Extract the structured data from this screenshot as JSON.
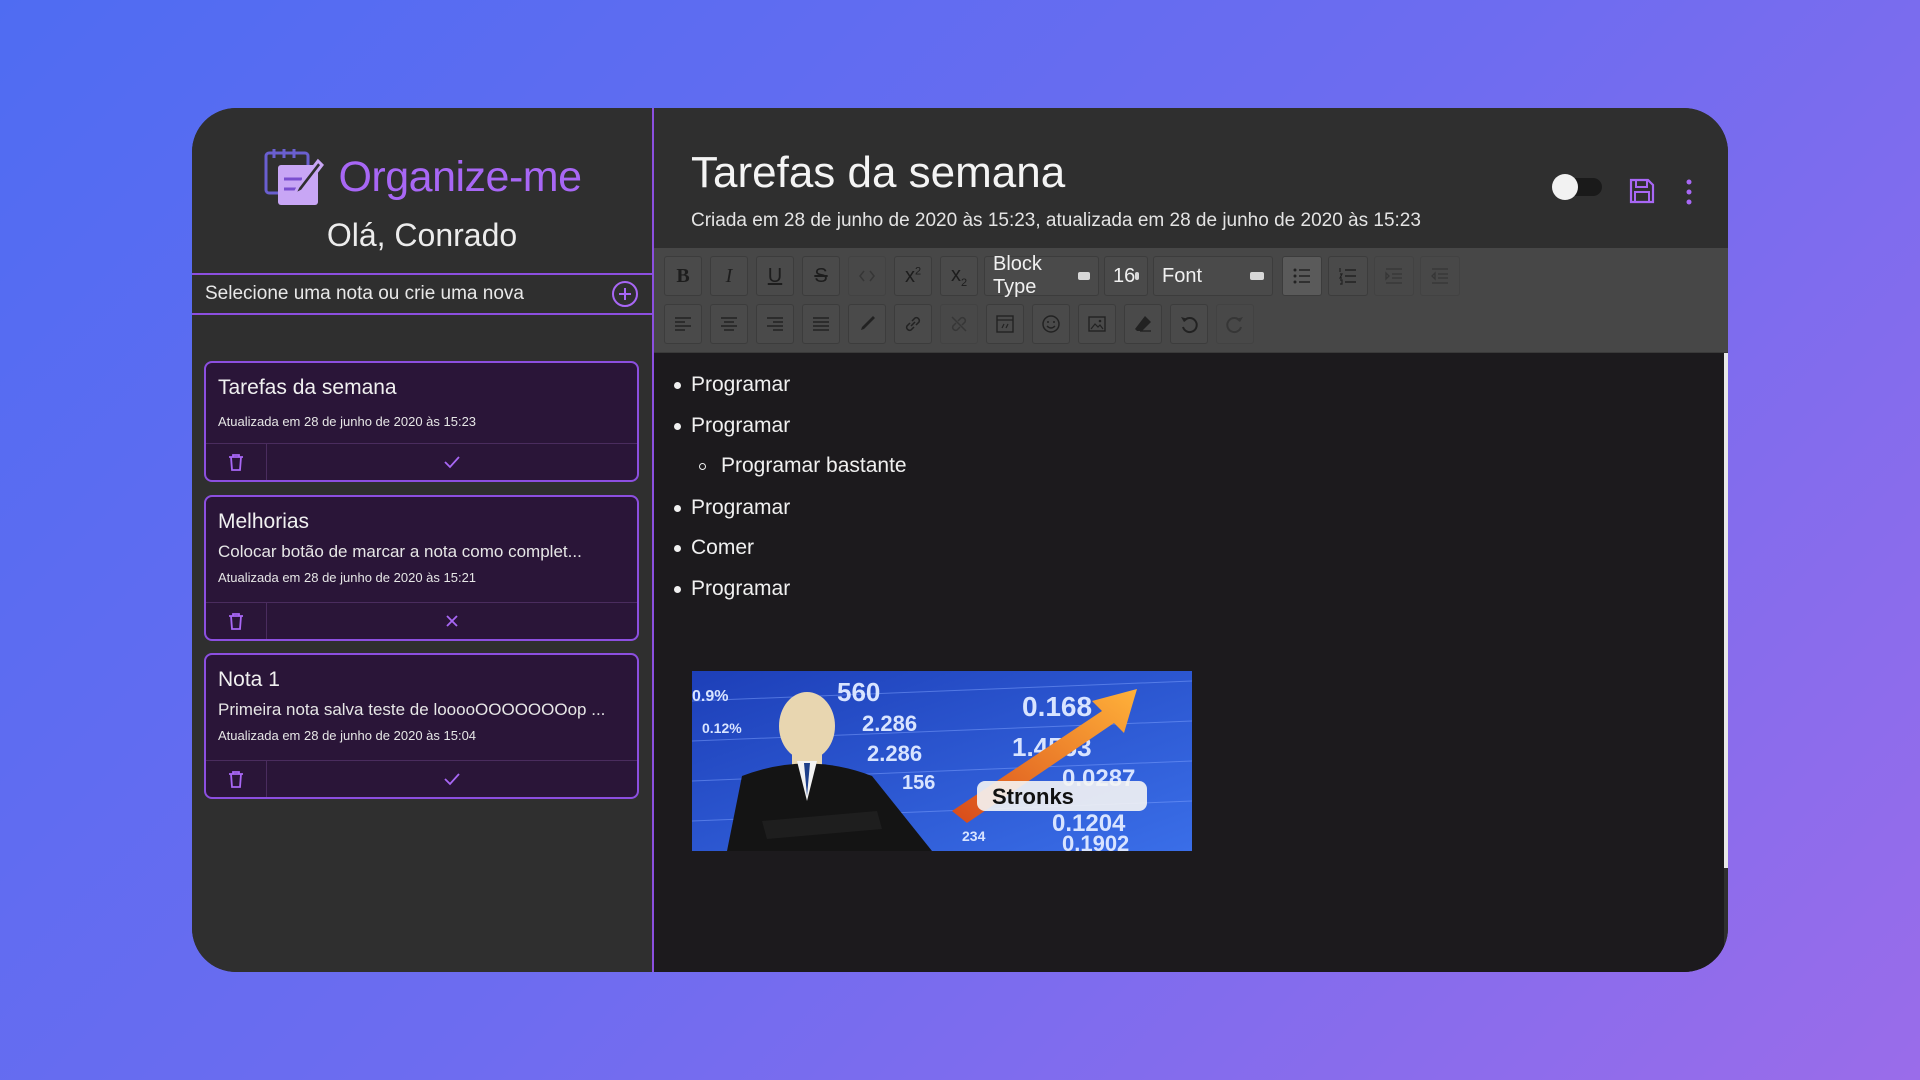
{
  "app": {
    "name": "Organize-me",
    "greeting": "Olá, Conrado"
  },
  "sidebar": {
    "prompt": "Selecione uma nota ou crie uma nova",
    "notes": [
      {
        "title": "Tarefas da semana",
        "preview": "",
        "updated": "Atualizada em 28 de junho de 2020 às 15:23",
        "status": "done"
      },
      {
        "title": "Melhorias",
        "preview": "Colocar botão de marcar a nota como complet...",
        "updated": "Atualizada em 28 de junho de 2020 às 15:21",
        "status": "pending"
      },
      {
        "title": "Nota 1",
        "preview": "Primeira nota salva teste de looooOOOOOOOop ...",
        "updated": "Atualizada em 28 de junho de 2020 às 15:04",
        "status": "done"
      }
    ]
  },
  "editor": {
    "title": "Tarefas da semana",
    "meta": "Criada em 28 de junho de 2020 às 15:23, atualizada em 28 de junho de 2020 às 15:23",
    "toolbar": {
      "block_type": "Block Type",
      "font_size": "16",
      "font": "Font"
    },
    "items": [
      {
        "text": "Programar",
        "level": 1
      },
      {
        "text": "Programar",
        "level": 1
      },
      {
        "text": "Programar bastante",
        "level": 2
      },
      {
        "text": "Programar",
        "level": 1
      },
      {
        "text": "Comer",
        "level": 1
      },
      {
        "text": "Programar",
        "level": 1
      }
    ],
    "image_caption": "Stronks",
    "image_numbers": [
      "560",
      "0.168",
      "1.4563",
      "0.0287",
      "0.1204",
      "0.1902",
      "2.286",
      "2.286",
      "156",
      "0.9%",
      "0.12%",
      "234"
    ]
  },
  "colors": {
    "accent": "#a867f5",
    "card_bg": "#2a1538",
    "panel": "#2f2f2f",
    "editor_bg": "#1c1a1d"
  }
}
